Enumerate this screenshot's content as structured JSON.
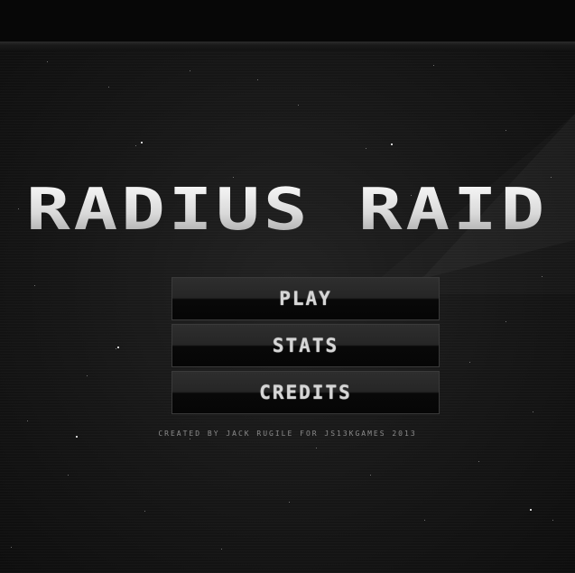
{
  "game": {
    "title": "RADIUS RAID",
    "menu": {
      "play_label": "PLAY",
      "stats_label": "STATS",
      "credits_label": "CREDITS"
    },
    "footer": "CREATED BY JACK RUGILE FOR JS13KGAMES 2013"
  },
  "colors": {
    "background": "#0b0b0b",
    "stage": "#1a1a1a",
    "text": "#d6d6d6",
    "footer_text": "#8c8c8c"
  }
}
